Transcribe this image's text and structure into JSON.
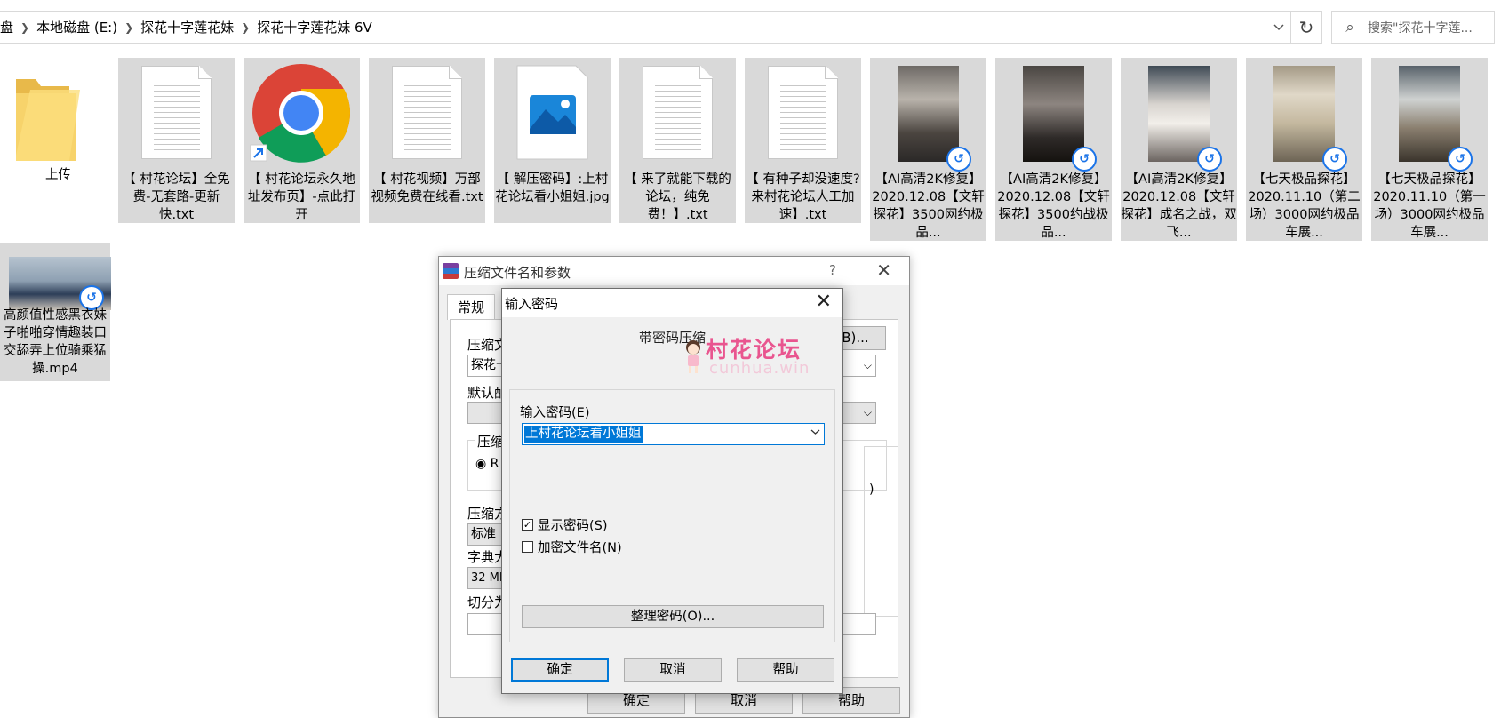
{
  "address_bar": {
    "crumbs": [
      "盘",
      "本地磁盘 (E:)",
      "探花十字莲花妹",
      "探花十字莲花妹 6V"
    ],
    "search_placeholder": "搜索\"探花十字莲..."
  },
  "files": [
    {
      "name": "上传",
      "type": "folder-icon"
    },
    {
      "name": "【 村花论坛】全免费-无套路-更新快.txt",
      "type": "text-file-icon"
    },
    {
      "name": "【 村花论坛永久地址发布页】-点此打开",
      "type": "chrome-shortcut-icon"
    },
    {
      "name": "【 村花视频】万部视频免费在线看.txt",
      "type": "text-file-icon"
    },
    {
      "name": "【 解压密码】:上村花论坛看小姐姐.jpg",
      "type": "image-file-icon"
    },
    {
      "name": "【 来了就能下载的论坛，纯免费！】.txt",
      "type": "text-file-icon"
    },
    {
      "name": "【 有种子却没速度?来村花论坛人工加速】.txt",
      "type": "text-file-icon"
    },
    {
      "name": "【AI高清2K修复】2020.12.08【文轩探花】3500网约极品...",
      "type": "video-thumbnail"
    },
    {
      "name": "【AI高清2K修复】2020.12.08【文轩探花】3500约战极品...",
      "type": "video-thumbnail"
    },
    {
      "name": "【AI高清2K修复】2020.12.08【文轩探花】成名之战，双飞...",
      "type": "video-thumbnail"
    },
    {
      "name": "【七天极品探花】2020.11.10（第二场）3000网约极品车展...",
      "type": "video-thumbnail"
    },
    {
      "name": "【七天极品探花】2020.11.10（第一场）3000网约极品车展...",
      "type": "video-thumbnail"
    },
    {
      "name": "高颜值性感黑衣妹子啪啪穿情趣装口交舔弄上位骑乘猛操.mp4",
      "type": "video-thumbnail"
    }
  ],
  "rar_dialog": {
    "title": "压缩文件名和参数",
    "help_glyph": "?",
    "tab": "常规",
    "archive_name_label": "压缩文",
    "archive_name_value": "探花十",
    "browse_button": "(B)...",
    "default_config_label": "默认配",
    "format_group_label": "压缩",
    "format_radio": "R",
    "method_label": "压缩方",
    "method_value": "标准",
    "dict_label": "字典大",
    "dict_value": "32 MB",
    "split_label": "切分为",
    "right_paren": ")",
    "ok": "确定",
    "cancel": "取消",
    "help": "帮助"
  },
  "password_dialog": {
    "title": "输入密码",
    "heading": "带密码压缩",
    "input_label": "输入密码(E)",
    "input_value": "上村花论坛看小姐姐",
    "show_password": {
      "label": "显示密码(S)",
      "checked": true
    },
    "encrypt_names": {
      "label": "加密文件名(N)",
      "checked": false
    },
    "organize_button": "整理密码(O)...",
    "ok": "确定",
    "cancel": "取消",
    "help": "帮助"
  },
  "watermark": {
    "title": "村花论坛",
    "subtitle": "cunhua.win"
  },
  "colors": {
    "selection": "#d9d9d9",
    "accent": "#0078d7",
    "watermark_pink": "#e9558f"
  }
}
